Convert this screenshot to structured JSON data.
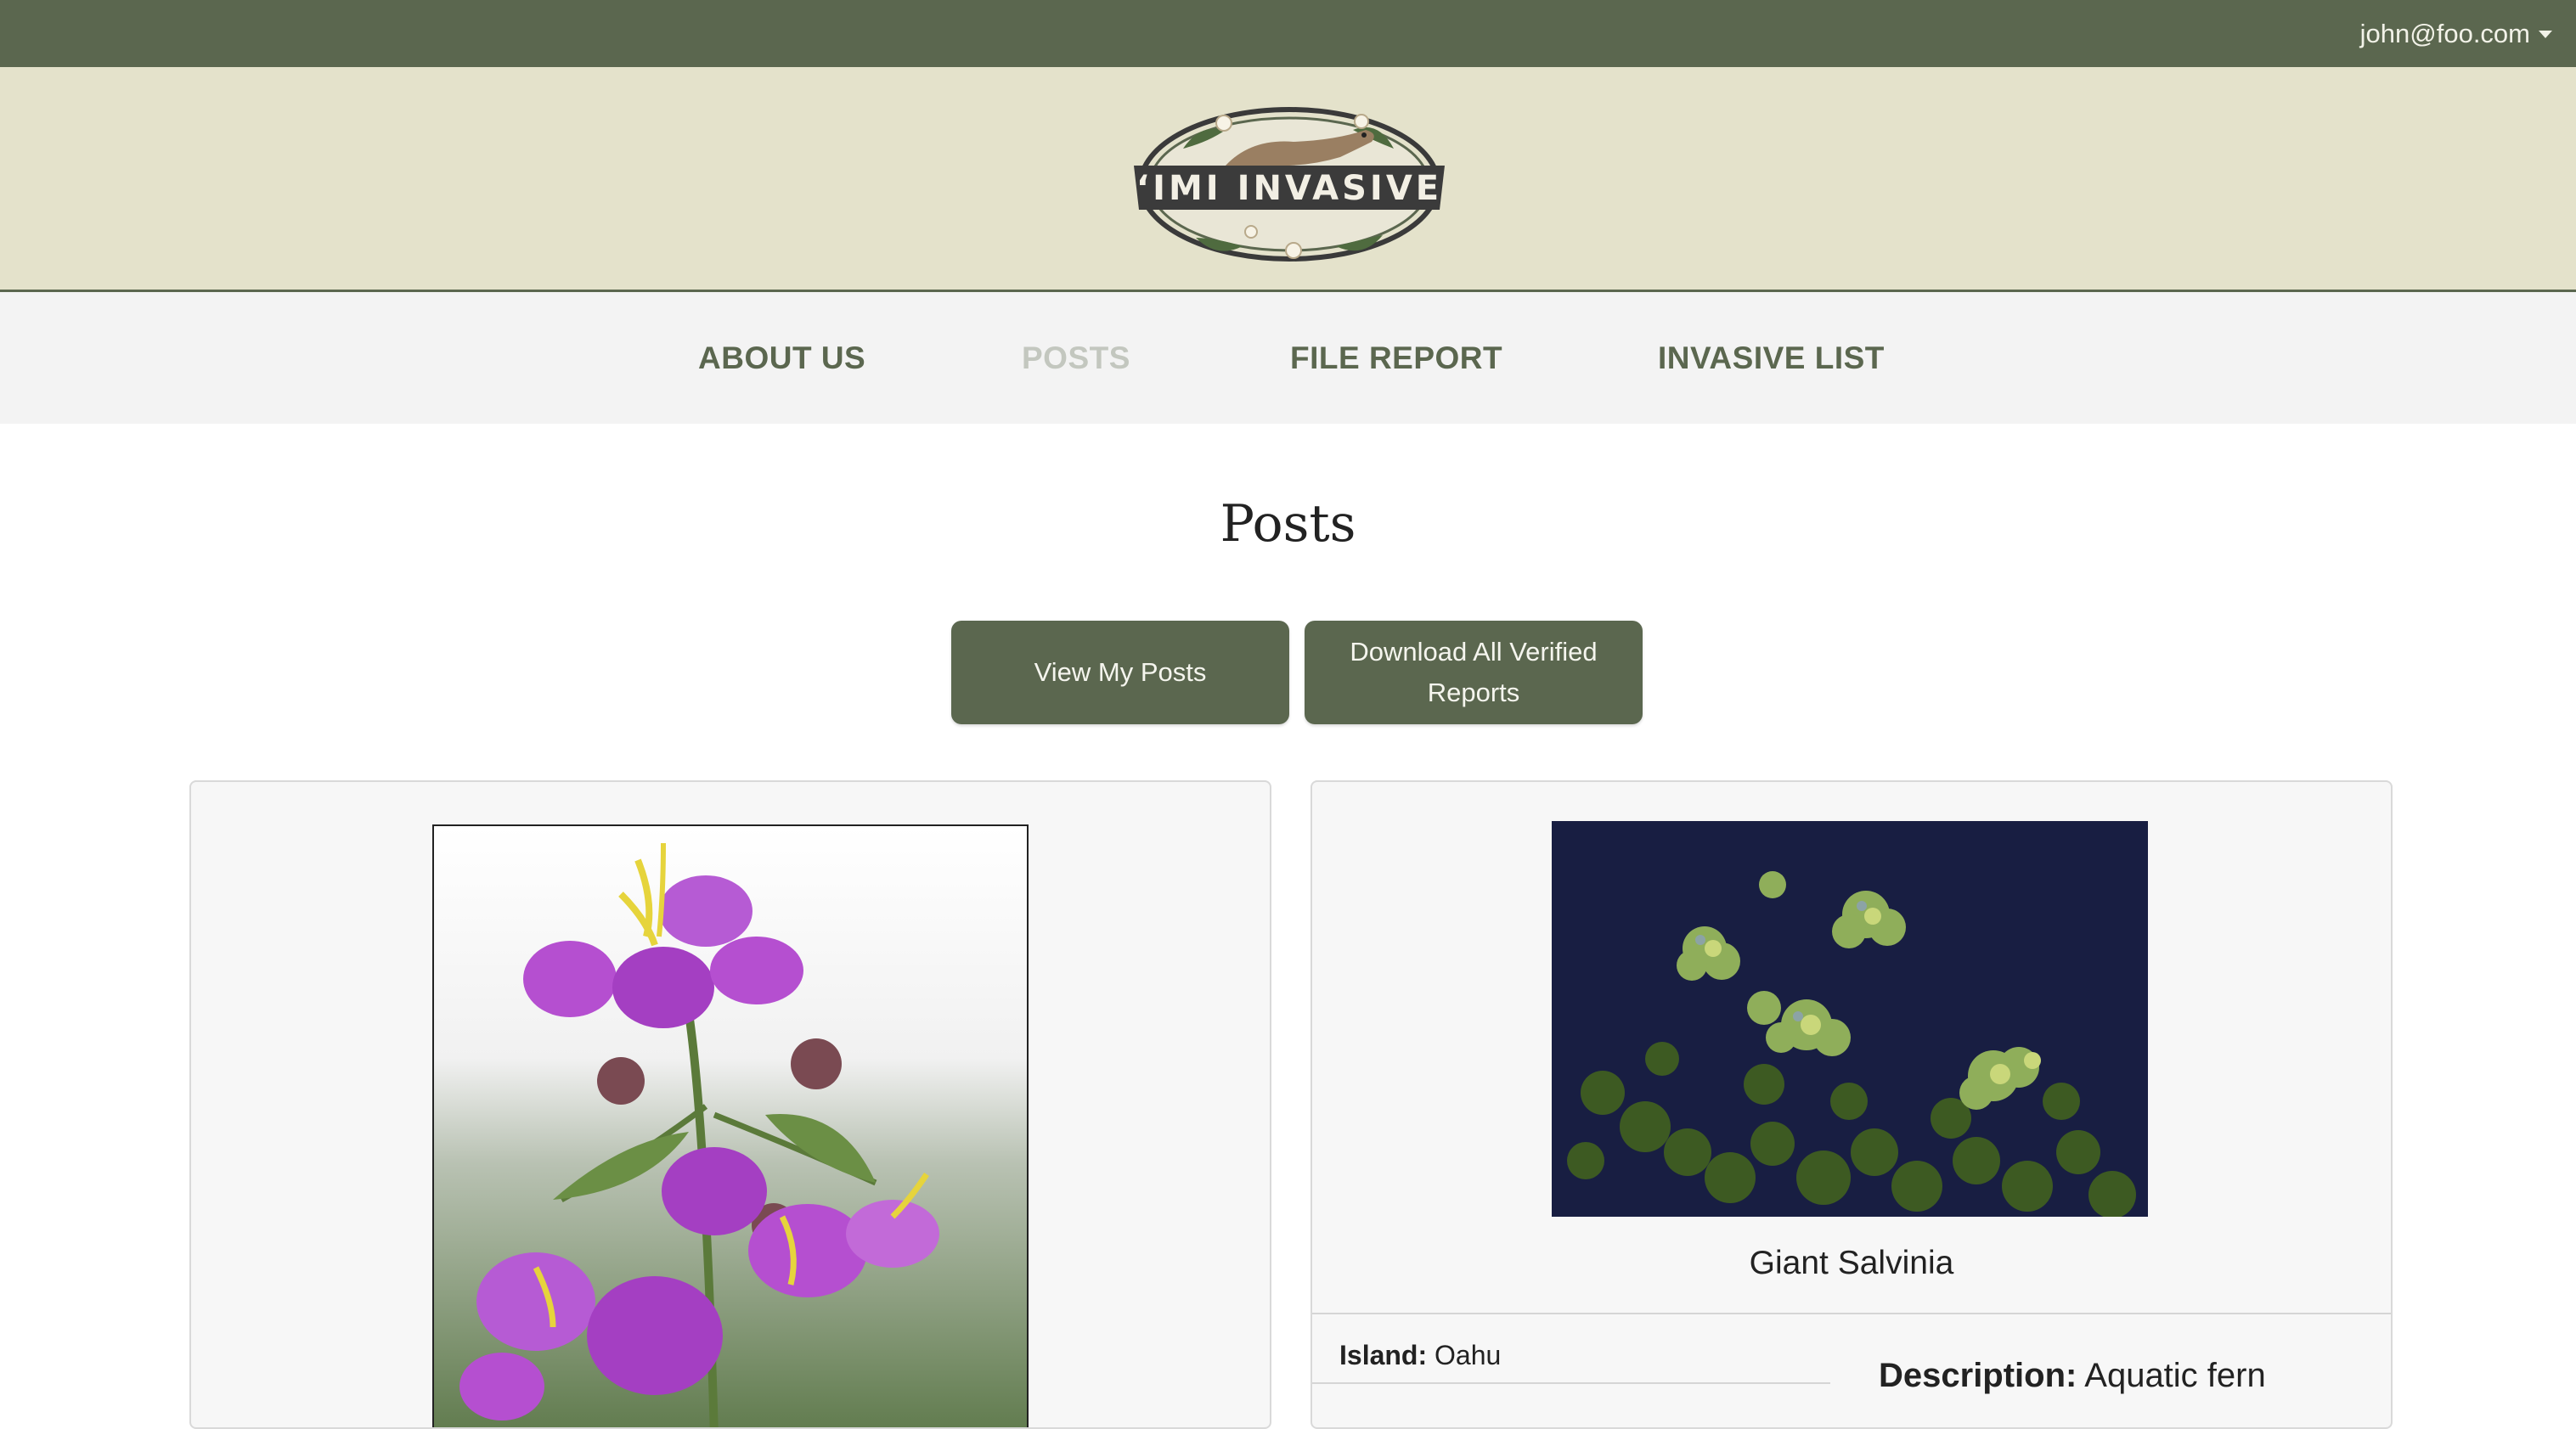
{
  "topbar": {
    "user_email": "john@foo.com"
  },
  "logo": {
    "text": "‘IMI INVASIVE"
  },
  "nav": {
    "items": [
      {
        "label": "ABOUT US",
        "active": false
      },
      {
        "label": "POSTS",
        "active": true
      },
      {
        "label": "FILE REPORT",
        "active": false
      },
      {
        "label": "INVASIVE LIST",
        "active": false
      }
    ]
  },
  "page": {
    "title": "Posts",
    "view_my_posts_label": "View My Posts",
    "download_label": "Download All Verified Reports"
  },
  "posts": [
    {
      "image_icon": "purple-flower-photo"
    },
    {
      "image_icon": "floating-fern-photo",
      "title": "Giant Salvinia",
      "island_label": "Island:",
      "island_value": "Oahu",
      "description_label": "Description:",
      "description_value": "Aquatic fern"
    }
  ],
  "colors": {
    "primary": "#5b674f",
    "logo_band": "#e4e2cb",
    "nav_bg": "#f3f3f3",
    "nav_active": "#c3c7bf"
  }
}
